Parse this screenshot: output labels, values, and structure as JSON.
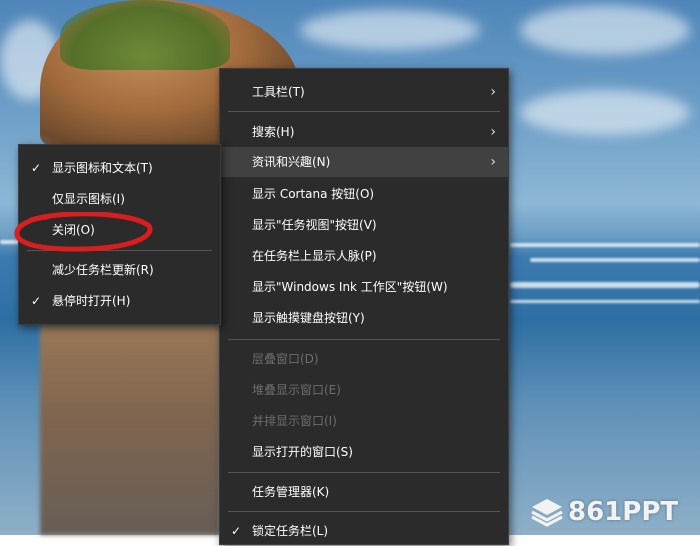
{
  "main_menu": {
    "items": [
      {
        "label": "工具栏(T)",
        "submenu": true
      },
      {
        "label": "搜索(H)",
        "submenu": true
      },
      {
        "label": "资讯和兴趣(N)",
        "submenu": true,
        "hover": true
      },
      {
        "label": "显示 Cortana 按钮(O)"
      },
      {
        "label": "显示\"任务视图\"按钮(V)"
      },
      {
        "label": "在任务栏上显示人脉(P)"
      },
      {
        "label": "显示\"Windows Ink 工作区\"按钮(W)"
      },
      {
        "label": "显示触摸键盘按钮(Y)"
      },
      {
        "label": "层叠窗口(D)",
        "disabled": true
      },
      {
        "label": "堆叠显示窗口(E)",
        "disabled": true
      },
      {
        "label": "并排显示窗口(I)",
        "disabled": true
      },
      {
        "label": "显示打开的窗口(S)"
      },
      {
        "label": "任务管理器(K)"
      },
      {
        "label": "锁定任务栏(L)",
        "checked": true
      }
    ]
  },
  "sub_menu": {
    "items": [
      {
        "label": "显示图标和文本(T)",
        "checked": true
      },
      {
        "label": "仅显示图标(I)"
      },
      {
        "label": "关闭(O)"
      },
      {
        "label": "减少任务栏更新(R)"
      },
      {
        "label": "悬停时打开(H)",
        "checked": true
      }
    ]
  },
  "icons": {
    "check": "✓",
    "chevron": "›"
  },
  "watermark": {
    "text": "861PPT"
  },
  "colors": {
    "menu_bg": "#2b2b2b",
    "hover_bg": "#414141",
    "annotation": "#d81e1e"
  }
}
